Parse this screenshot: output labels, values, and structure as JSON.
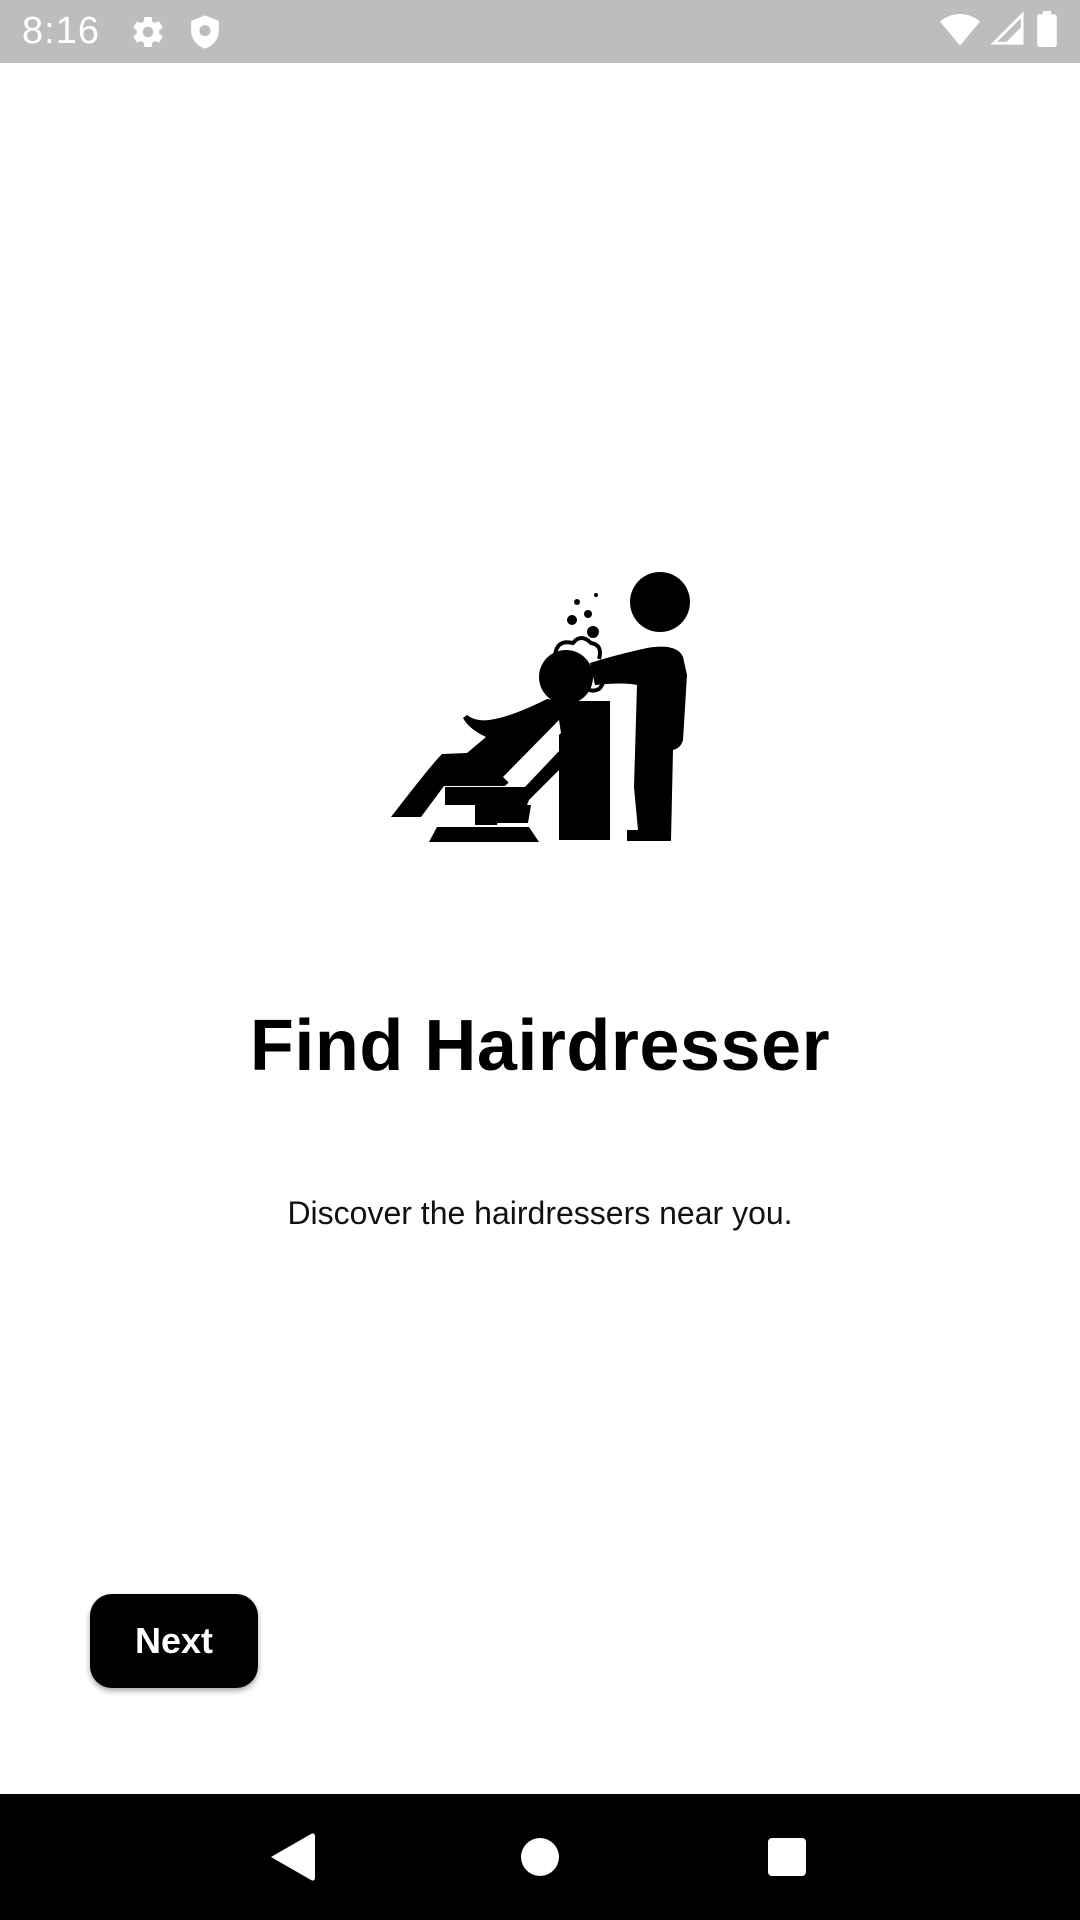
{
  "status_bar": {
    "time": "8:16",
    "icons": [
      "gear-icon",
      "shield-icon",
      "wifi-icon",
      "signal-icon",
      "battery-icon"
    ],
    "background": "#bdbdbd"
  },
  "onboarding": {
    "illustration": "hairdresser-washing-hair-icon",
    "title": "Find Hairdresser",
    "subtitle": "Discover the hairdressers near you.",
    "next_label": "Next"
  },
  "nav_bar": {
    "buttons": [
      "back-icon",
      "home-icon",
      "recents-icon"
    ],
    "background": "#000000"
  }
}
